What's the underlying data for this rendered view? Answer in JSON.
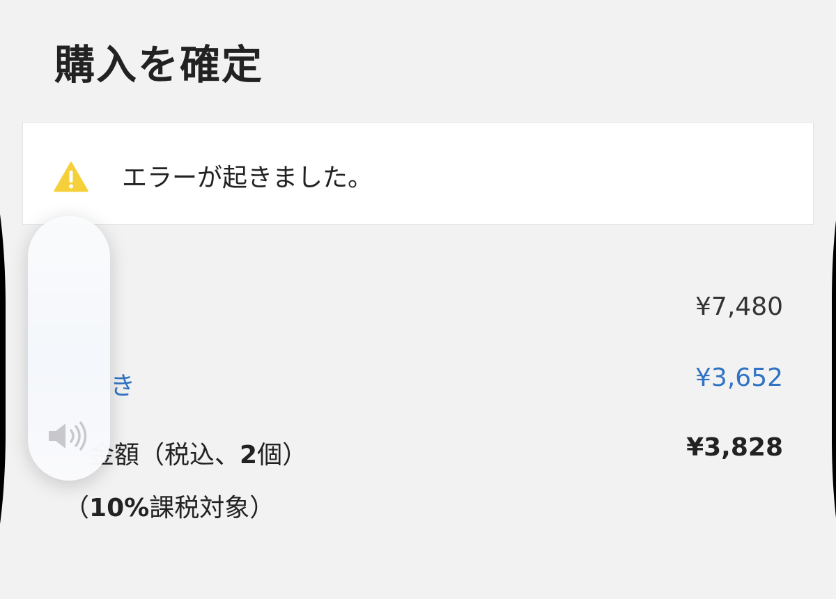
{
  "page": {
    "title": "購入を確定"
  },
  "error": {
    "icon": "warning-icon",
    "message": "エラーが起きました。",
    "icon_color": "#f5d03a"
  },
  "summary": {
    "subtotal_value": "¥7,480",
    "discount_label": "き",
    "discount_value": "¥3,652",
    "total_label_part1": "金額（税込、",
    "total_label_bold": "2",
    "total_label_part2": "個）",
    "total_value": "¥3,828",
    "tax_label_open": "（",
    "tax_label_bold": "10%",
    "tax_label_rest": "課税対象）"
  },
  "volume_hud": {
    "icon": "speaker-icon",
    "level": 0.0
  },
  "colors": {
    "background": "#f2f2f2",
    "link_blue": "#2f73c2",
    "text": "#222222"
  }
}
